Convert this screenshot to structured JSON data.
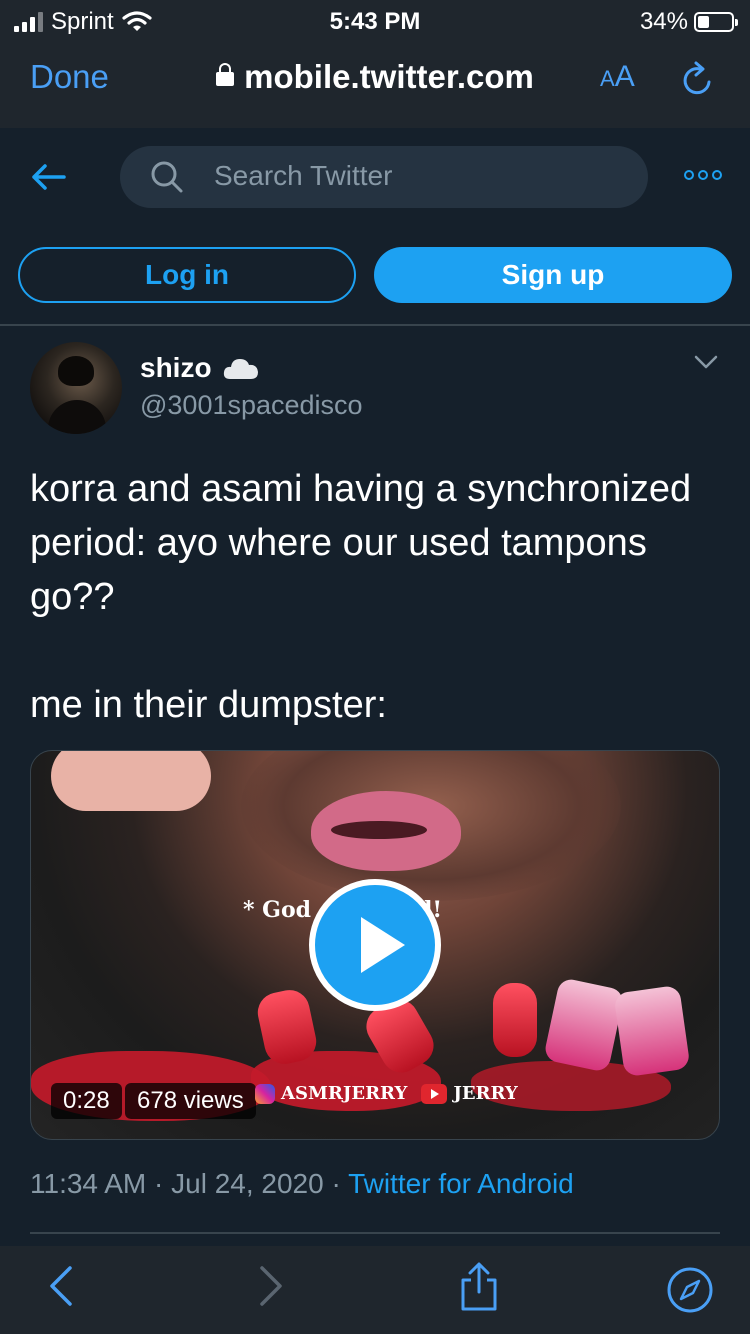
{
  "status_bar": {
    "carrier": "Sprint",
    "time": "5:43 PM",
    "battery": "34%",
    "battery_level": 0.34
  },
  "browser": {
    "done_label": "Done",
    "url": "mobile.twitter.com",
    "text_size_label": "AA"
  },
  "twitter_header": {
    "search_placeholder": "Search Twitter",
    "login_label": "Log in",
    "signup_label": "Sign up"
  },
  "tweet": {
    "display_name": "shizo",
    "name_emoji": "cloud-icon",
    "handle": "@3001spacedisco",
    "text_line1": "korra and asami having a synchronized period: ayo where our used tampons go??",
    "text_line2": "me in their dumpster:",
    "video": {
      "caption_left": "* God",
      "caption_right": "d!",
      "duration": "0:28",
      "views": "678 views",
      "watermark_ig": "ASMRJERRY",
      "watermark_yt": "JERRY"
    },
    "time": "11:34 AM",
    "separator": "·",
    "date": "Jul 24, 2020",
    "source": "Twitter for Android"
  },
  "colors": {
    "background": "#15202b",
    "accent": "#1da1f2",
    "muted": "#8899a6",
    "ios_link": "#4a9ff5"
  }
}
